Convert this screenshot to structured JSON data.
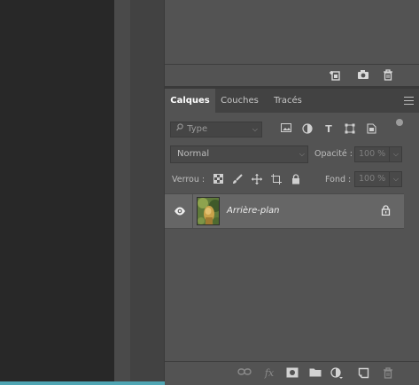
{
  "panel_tabs": {
    "calques": "Calques",
    "couches": "Couches",
    "traces": "Tracés"
  },
  "filter": {
    "kind_placeholder": "Type"
  },
  "blend": {
    "mode": "Normal",
    "opacity_label": "Opacité :",
    "opacity_value": "100 %",
    "fill_label": "Fond :",
    "fill_value": "100 %"
  },
  "lock": {
    "label": "Verrou :"
  },
  "layers": [
    {
      "name": "Arrière-plan",
      "visible": true,
      "locked": true
    }
  ],
  "icons": {
    "top_footer": [
      "new-snapshot-icon",
      "camera-icon",
      "trash-icon"
    ],
    "filter": [
      "image-filter-icon",
      "adjustment-filter-icon",
      "type-filter-icon",
      "shape-filter-icon",
      "smart-object-filter-icon"
    ],
    "lock": [
      "lock-transparent-icon",
      "lock-image-icon",
      "lock-position-icon",
      "lock-artboard-icon",
      "lock-all-icon"
    ],
    "footer": [
      "link-layers-icon",
      "fx-icon",
      "add-mask-icon",
      "new-group-icon",
      "adjustment-layer-icon",
      "new-layer-icon",
      "delete-layer-icon"
    ]
  },
  "colors": {
    "panel_bg": "#535353",
    "canvas_bg": "#282828",
    "selected_layer": "#666666",
    "accent_strip": "#4fa5b3"
  }
}
